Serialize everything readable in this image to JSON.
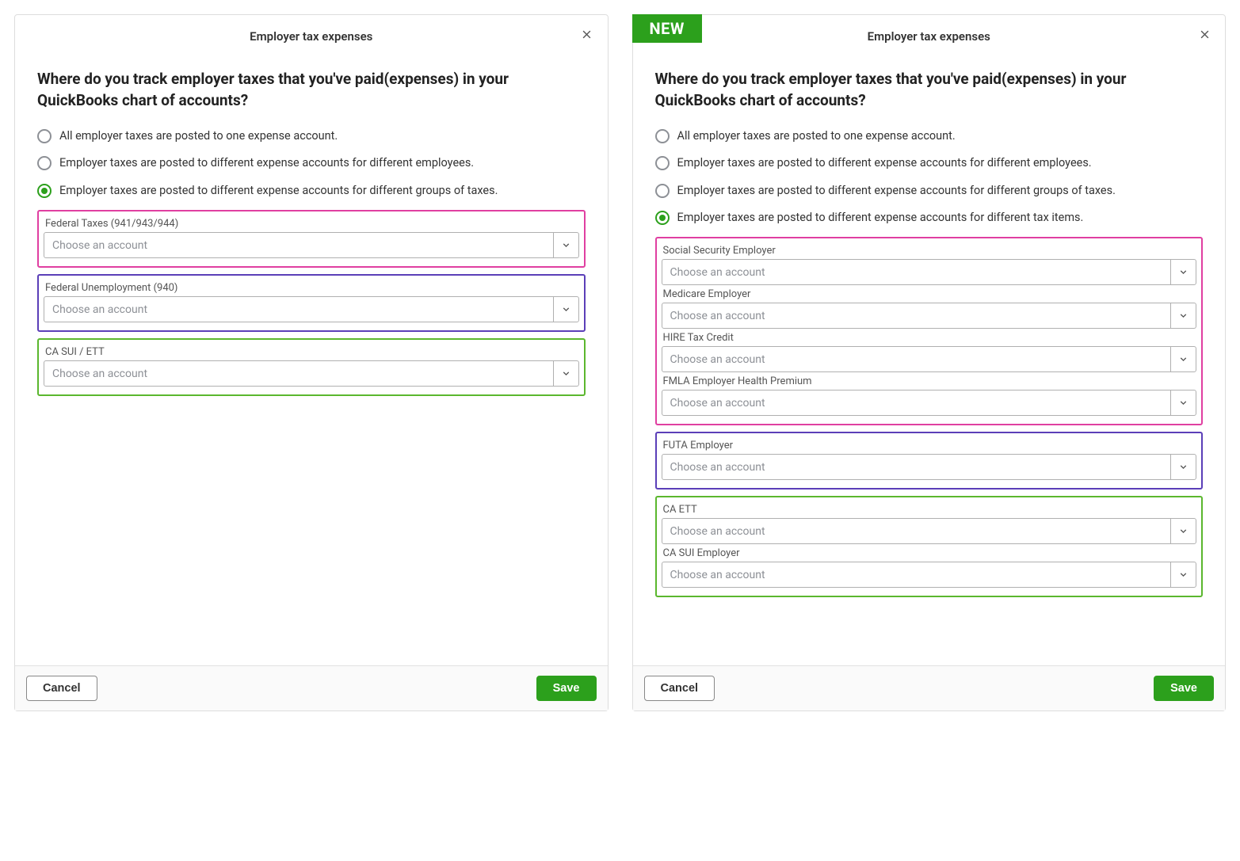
{
  "common": {
    "title": "Employer tax expenses",
    "question": "Where do you track employer taxes that you've paid(expenses) in your QuickBooks chart of accounts?",
    "select_placeholder": "Choose an account",
    "cancel": "Cancel",
    "save": "Save",
    "new_badge": "NEW"
  },
  "left": {
    "radios": {
      "r0": "All employer taxes are posted to one expense account.",
      "r1": "Employer taxes are posted to different expense accounts for different employees.",
      "r2": "Employer taxes are posted to different expense accounts for different groups of taxes."
    },
    "fields": {
      "f0": "Federal Taxes (941/943/944)",
      "f1": "Federal Unemployment (940)",
      "f2": "CA SUI / ETT"
    }
  },
  "right": {
    "radios": {
      "r0": "All employer taxes are posted to one expense account.",
      "r1": "Employer taxes are posted to different expense accounts for different employees.",
      "r2": "Employer taxes are posted to different expense accounts for different groups of taxes.",
      "r3": "Employer taxes are posted to different expense accounts for different tax items."
    },
    "fields": {
      "f0": "Social Security Employer",
      "f1": "Medicare Employer",
      "f2": "HIRE Tax Credit",
      "f3": "FMLA Employer Health Premium",
      "f4": "FUTA Employer",
      "f5": "CA ETT",
      "f6": "CA SUI Employer"
    }
  }
}
